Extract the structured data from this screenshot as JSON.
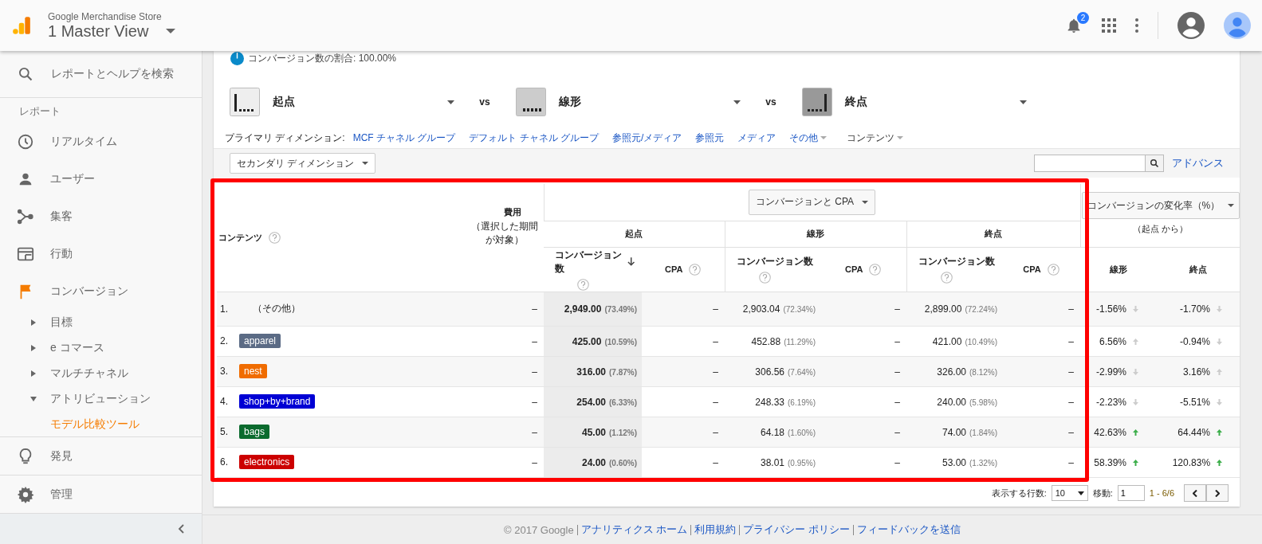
{
  "header": {
    "account": "Google Merchandise Store",
    "view": "1 Master View",
    "notification_count": "2"
  },
  "sidebar": {
    "search": "レポートとヘルプを検索",
    "section": "レポート",
    "items": [
      {
        "label": "リアルタイム",
        "selected": false
      },
      {
        "label": "ユーザー",
        "selected": false
      },
      {
        "label": "集客",
        "selected": false
      },
      {
        "label": "行動",
        "selected": false
      },
      {
        "label": "コンバージョン",
        "selected": true,
        "children": [
          {
            "label": "目標",
            "expanded": false
          },
          {
            "label": "e コマース",
            "expanded": false
          },
          {
            "label": "マルチチャネル",
            "expanded": false
          },
          {
            "label": "アトリビューション",
            "expanded": true,
            "children": [
              {
                "label": "モデル比較ツール",
                "selected": true
              }
            ]
          }
        ]
      },
      {
        "label": "発見",
        "selected": false
      },
      {
        "label": "管理",
        "selected": false
      }
    ]
  },
  "conversion_share": "コンバージョン数の割合: 100.00%",
  "models": [
    {
      "name": "起点",
      "kind": "first"
    },
    {
      "name": "線形",
      "kind": "linear"
    },
    {
      "name": "終点",
      "kind": "last"
    }
  ],
  "vs_labels": [
    "vs",
    "vs"
  ],
  "primary_dimension": {
    "label": "プライマリ ディメンション:",
    "options": [
      {
        "label": "MCF チャネル グループ",
        "selected": false,
        "dropdown": false
      },
      {
        "label": "デフォルト チャネル グループ",
        "selected": false,
        "dropdown": false
      },
      {
        "label": "参照元/メディア",
        "selected": false,
        "dropdown": false
      },
      {
        "label": "参照元",
        "selected": false,
        "dropdown": false
      },
      {
        "label": "メディア",
        "selected": false,
        "dropdown": false
      },
      {
        "label": "その他",
        "selected": false,
        "dropdown": true
      },
      {
        "label": "コンテンツ",
        "selected": true,
        "dropdown": true
      }
    ]
  },
  "secondary_dimension": "セカンダリ ディメンション",
  "advanced_link": "アドバンス",
  "table": {
    "content_header": "コンテンツ",
    "cost_header": "費用",
    "cost_note": "（選択した期間が対象）",
    "metric_selector": "コンバージョンと CPA",
    "model_headers": [
      {
        "name": "起点",
        "conversions_header": "コンバージョン数",
        "cpa_header": "CPA"
      },
      {
        "name": "線形",
        "conversions_header": "コンバージョン数",
        "cpa_header": "CPA"
      },
      {
        "name": "終点",
        "conversions_header": "コンバージョン数",
        "cpa_header": "CPA"
      }
    ],
    "change_selector": "コンバージョンの変化率（%）",
    "change_note": "（起点 から）",
    "change_headers": [
      "線形",
      "終点"
    ],
    "rows": [
      {
        "index": "1.",
        "label": "（その他）",
        "kind": "plain",
        "cost": "–",
        "models": [
          {
            "value": "2,949.00",
            "share": "(73.49%)",
            "cpa": "–"
          },
          {
            "value": "2,903.04",
            "share": "(72.34%)",
            "cpa": "–"
          },
          {
            "value": "2,899.00",
            "share": "(72.24%)",
            "cpa": "–"
          }
        ],
        "changes": [
          {
            "value": "-1.56%",
            "up": false,
            "significant": false
          },
          {
            "value": "-1.70%",
            "up": false,
            "significant": false
          }
        ]
      },
      {
        "index": "2.",
        "label": "apparel",
        "kind": "tag",
        "color": "#5b6b85",
        "cost": "–",
        "models": [
          {
            "value": "425.00",
            "share": "(10.59%)",
            "cpa": "–"
          },
          {
            "value": "452.88",
            "share": "(11.29%)",
            "cpa": "–"
          },
          {
            "value": "421.00",
            "share": "(10.49%)",
            "cpa": "–"
          }
        ],
        "changes": [
          {
            "value": "6.56%",
            "up": true,
            "significant": false
          },
          {
            "value": "-0.94%",
            "up": false,
            "significant": false
          }
        ]
      },
      {
        "index": "3.",
        "label": "nest",
        "kind": "tag",
        "color": "#f06c00",
        "cost": "–",
        "models": [
          {
            "value": "316.00",
            "share": "(7.87%)",
            "cpa": "–"
          },
          {
            "value": "306.56",
            "share": "(7.64%)",
            "cpa": "–"
          },
          {
            "value": "326.00",
            "share": "(8.12%)",
            "cpa": "–"
          }
        ],
        "changes": [
          {
            "value": "-2.99%",
            "up": false,
            "significant": false
          },
          {
            "value": "3.16%",
            "up": true,
            "significant": false
          }
        ]
      },
      {
        "index": "4.",
        "label": "shop+by+brand",
        "kind": "tag",
        "color": "#0000d4",
        "cost": "–",
        "models": [
          {
            "value": "254.00",
            "share": "(6.33%)",
            "cpa": "–"
          },
          {
            "value": "248.33",
            "share": "(6.19%)",
            "cpa": "–"
          },
          {
            "value": "240.00",
            "share": "(5.98%)",
            "cpa": "–"
          }
        ],
        "changes": [
          {
            "value": "-2.23%",
            "up": false,
            "significant": false
          },
          {
            "value": "-5.51%",
            "up": false,
            "significant": false
          }
        ]
      },
      {
        "index": "5.",
        "label": "bags",
        "kind": "tag",
        "color": "#0b6b2e",
        "cost": "–",
        "models": [
          {
            "value": "45.00",
            "share": "(1.12%)",
            "cpa": "–"
          },
          {
            "value": "64.18",
            "share": "(1.60%)",
            "cpa": "–"
          },
          {
            "value": "74.00",
            "share": "(1.84%)",
            "cpa": "–"
          }
        ],
        "changes": [
          {
            "value": "42.63%",
            "up": true,
            "significant": true
          },
          {
            "value": "64.44%",
            "up": true,
            "significant": true
          }
        ]
      },
      {
        "index": "6.",
        "label": "electronics",
        "kind": "tag",
        "color": "#cc0000",
        "cost": "–",
        "models": [
          {
            "value": "24.00",
            "share": "(0.60%)",
            "cpa": "–"
          },
          {
            "value": "38.01",
            "share": "(0.95%)",
            "cpa": "–"
          },
          {
            "value": "53.00",
            "share": "(1.32%)",
            "cpa": "–"
          }
        ],
        "changes": [
          {
            "value": "58.39%",
            "up": true,
            "significant": true
          },
          {
            "value": "120.83%",
            "up": true,
            "significant": true
          }
        ]
      }
    ]
  },
  "pagination": {
    "rows_label": "表示する行数:",
    "rows_value": "10",
    "goto_label": "移動:",
    "goto_value": "1",
    "range": "1 - 6/6"
  },
  "footer": {
    "copyright": "© 2017 Google",
    "links": [
      "アナリティクス ホーム",
      "利用規約",
      "プライバシー ポリシー",
      "フィードバックを送信"
    ]
  }
}
